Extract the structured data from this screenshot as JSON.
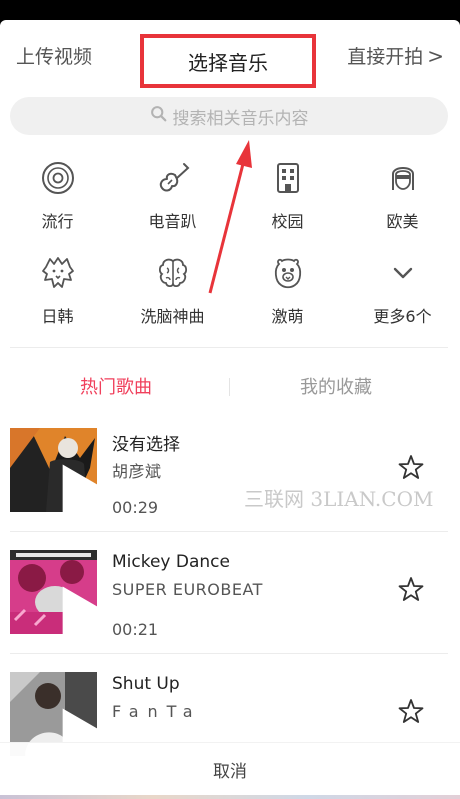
{
  "header": {
    "left_label": "上传视频",
    "title": "选择音乐",
    "right_label": "直接开拍",
    "right_chevron": ">"
  },
  "search": {
    "placeholder": "搜索相关音乐内容",
    "icon": "search-icon"
  },
  "categories": [
    {
      "label": "流行",
      "icon": "vinyl-disc-icon"
    },
    {
      "label": "电音趴",
      "icon": "guitar-icon"
    },
    {
      "label": "校园",
      "icon": "building-icon"
    },
    {
      "label": "欧美",
      "icon": "woman-face-icon"
    },
    {
      "label": "日韩",
      "icon": "lion-icon"
    },
    {
      "label": "洗脑神曲",
      "icon": "brain-icon"
    },
    {
      "label": "激萌",
      "icon": "cute-animal-icon"
    },
    {
      "label": "更多6个",
      "icon": "chevron-down-icon"
    }
  ],
  "tabs": [
    {
      "label": "热门歌曲",
      "active": true
    },
    {
      "label": "我的收藏",
      "active": false
    }
  ],
  "songs": [
    {
      "title": "没有选择",
      "artist": "胡彦斌",
      "duration": "00:29"
    },
    {
      "title": "Mickey Dance",
      "artist": "SUPER EUROBEAT",
      "duration": "00:21"
    },
    {
      "title": "Shut Up",
      "artist": "FanTa",
      "duration": ""
    }
  ],
  "watermark": "三联网 3LIAN.COM",
  "cancel_label": "取消",
  "colors": {
    "accent": "#f0405c",
    "highlight_box": "#e8343a",
    "annotation_arrow": "#e8343a"
  }
}
